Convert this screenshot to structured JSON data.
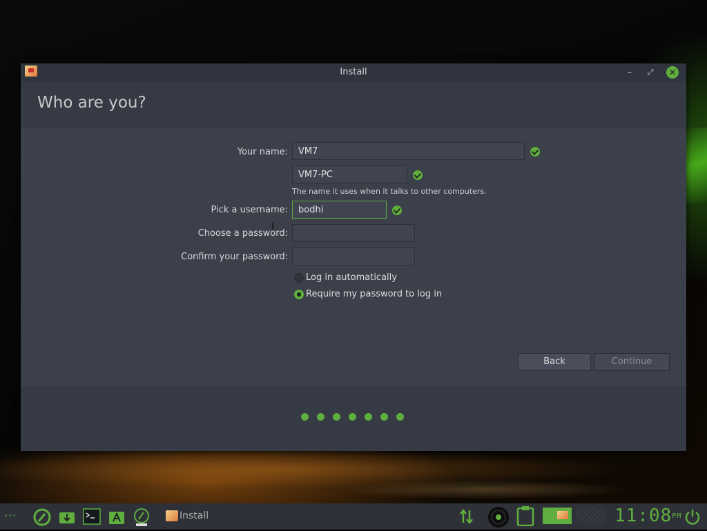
{
  "window": {
    "title": "Install",
    "minimize": "–",
    "maximize": "⤢",
    "close": "✕"
  },
  "page": {
    "heading": "Who are you?"
  },
  "form": {
    "name_label": "Your name:",
    "name_value": "VM7",
    "computer_value": "VM7-PC",
    "computer_hint": "The name it uses when it talks to other computers.",
    "username_label": "Pick a username:",
    "username_value": "bodhi",
    "password_label": "Choose a password:",
    "password_value": "",
    "confirm_label": "Confirm your password:",
    "confirm_value": "",
    "login_auto_label": "Log in automatically",
    "login_auto_selected": false,
    "require_password_label": "Require my password to log in",
    "require_password_selected": true
  },
  "buttons": {
    "back": "Back",
    "continue": "Continue"
  },
  "progress": {
    "total_steps": 7
  },
  "taskbar": {
    "task_label": "Install",
    "clock": "11:08",
    "clock_suffix": "PM",
    "launcher_dots": "···"
  },
  "colors": {
    "accent": "#5fae3e",
    "window_bg": "#353a45",
    "content_bg": "#3b404b"
  }
}
